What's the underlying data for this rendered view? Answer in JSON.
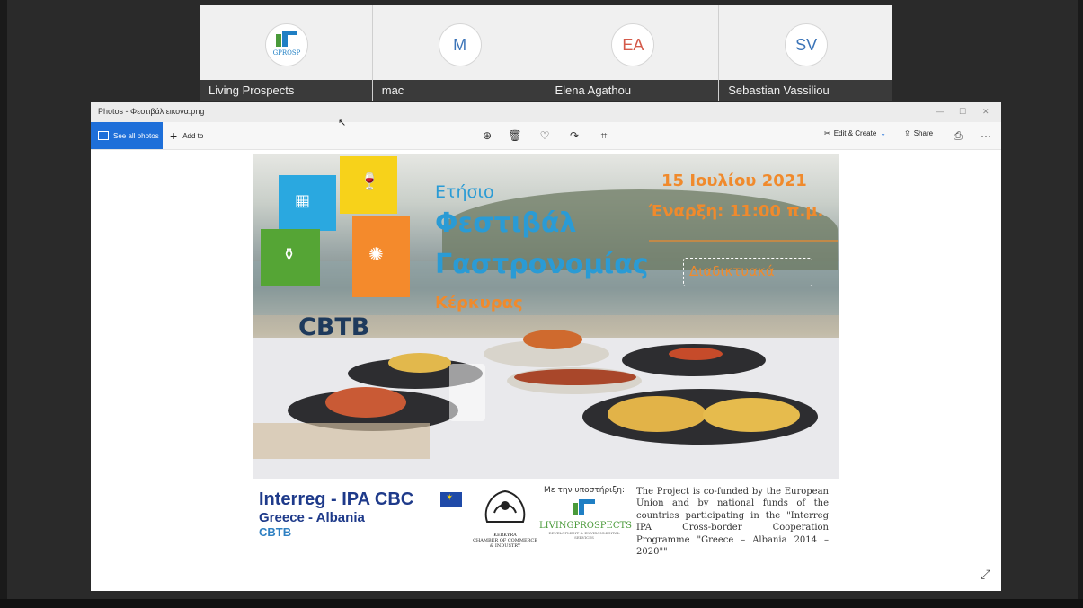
{
  "participants": [
    {
      "name": "Living Prospects",
      "initials": "",
      "logo_text": "GPROSP"
    },
    {
      "name": "mac",
      "initials": "M"
    },
    {
      "name": "Elena Agathou",
      "initials": "EA"
    },
    {
      "name": "Sebastian Vassiliou",
      "initials": "SV"
    }
  ],
  "window": {
    "title": "Photos - Φεστιβάλ εικονα.png",
    "see_all_photos": "See all photos",
    "add_to": "Add to",
    "edit_create": "Edit & Create",
    "share": "Share",
    "more": "···"
  },
  "icons": {
    "zoom": "zoom-icon",
    "delete": "trash-icon",
    "favorite": "heart-icon",
    "rotate": "rotate-icon",
    "crop": "crop-icon",
    "print": "print-icon",
    "expand": "expand-icon"
  },
  "poster": {
    "line1": "Ετήσιο",
    "line2": "Φεστιβάλ",
    "line3": "Γαστρονομίας",
    "line4": "Κέρκυρας",
    "date": "15 Ιουλίου 2021",
    "start": "Έναρξη: 11:00 π.μ.",
    "online": "Διαδικτυακά",
    "cbtb": "CBTB",
    "interreg": "Interreg - IPA CBC",
    "greece_albania": "Greece - Albania",
    "cbtb_small": "CBTB",
    "kerkyra_line1": "KERKYRA",
    "kerkyra_line2": "CHAMBER OF COMMERCE",
    "kerkyra_line3": "& INDUSTRY",
    "support": "Με την υποστήριξη:",
    "lp_brand": "LIVINGPROSPECTS",
    "lp_sub": "DEVELOPMENT & ENVIRONMENTAL SERVICES",
    "cofund": "The Project is co-funded by the European Union and by national funds of the countries participating in the \"Interreg IPA Cross-border Cooperation Programme \"Greece – Albania 2014 – 2020\"\""
  },
  "colors": {
    "accent_blue": "#1e6fd9",
    "poster_blue": "#2a9bd5",
    "poster_orange": "#f08a2c"
  }
}
